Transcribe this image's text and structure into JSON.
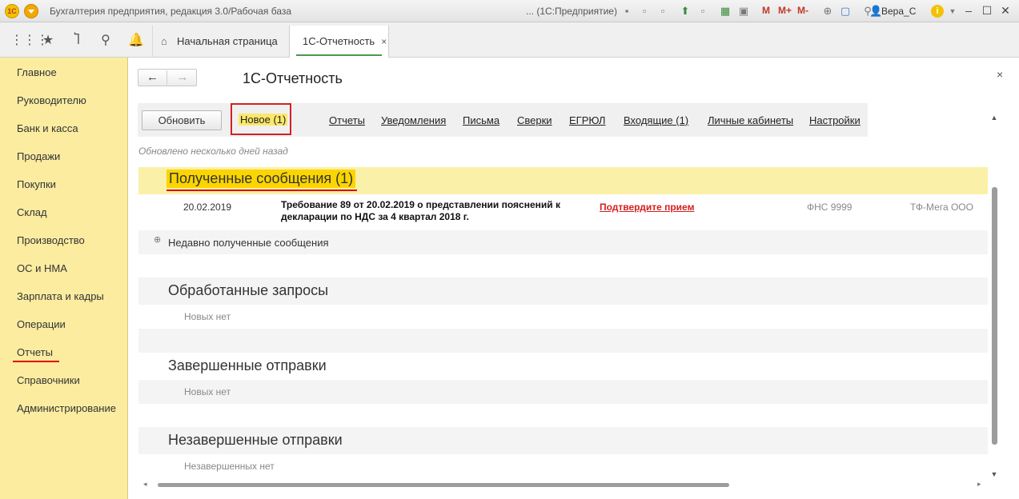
{
  "titlebar": {
    "logo": "1С",
    "title": "Бухгалтерия предприятия, редакция 3.0/Рабочая база",
    "mode": "... (1С:Предприятие)",
    "m": "M",
    "m_plus": "M+",
    "m_minus": "M-",
    "user": "Вера_С"
  },
  "tabs": {
    "home": "Начальная страница",
    "active": "1С-Отчетность",
    "close": "×"
  },
  "sidebar": {
    "items": [
      {
        "label": "Главное"
      },
      {
        "label": "Руководителю"
      },
      {
        "label": "Банк и касса"
      },
      {
        "label": "Продажи"
      },
      {
        "label": "Покупки"
      },
      {
        "label": "Склад"
      },
      {
        "label": "Производство"
      },
      {
        "label": "ОС и НМА"
      },
      {
        "label": "Зарплата и кадры"
      },
      {
        "label": "Операции"
      },
      {
        "label": "Отчеты"
      },
      {
        "label": "Справочники"
      },
      {
        "label": "Администрирование"
      }
    ]
  },
  "main": {
    "title": "1С-Отчетность",
    "refresh": "Обновить",
    "new_link": "Новое (1)",
    "links": [
      "Отчеты",
      "Уведомления",
      "Письма",
      "Сверки",
      "ЕГРЮЛ",
      "Входящие (1)",
      "Личные кабинеты",
      "Настройки"
    ],
    "updated": "Обновлено несколько дней назад",
    "received": {
      "title": "Полученные сообщения (1)",
      "message": {
        "date": "20.02.2019",
        "text": "Требование 89 от 20.02.2019 о представлении пояснений к декларации по НДС за 4 квартал 2018 г.",
        "action": "Подтвердите прием",
        "org": "ФНС 9999",
        "company": "ТФ-Мега ООО"
      },
      "recent": "Недавно полученные сообщения"
    },
    "processed": {
      "title": "Обработанные запросы",
      "empty": "Новых нет"
    },
    "completed": {
      "title": "Завершенные отправки",
      "empty": "Новых нет"
    },
    "incomplete": {
      "title": "Незавершенные отправки",
      "empty": "Незавершенных нет"
    }
  }
}
